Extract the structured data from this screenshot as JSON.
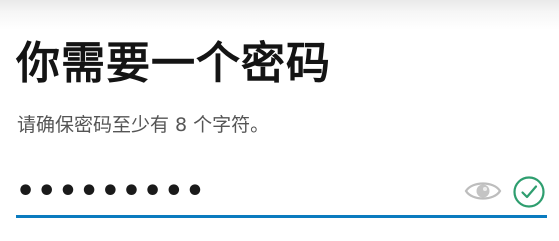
{
  "header": {
    "title": "你需要一个密码",
    "subtitle": "请确保密码至少有 8 个字符。"
  },
  "password_field": {
    "masked_value": "•••••••••",
    "reveal_icon": "eye-icon",
    "valid_icon": "check-circle-icon"
  },
  "colors": {
    "underline": "#0a7bbf",
    "valid": "#2e9e6f",
    "eye": "#bdbdbd"
  }
}
